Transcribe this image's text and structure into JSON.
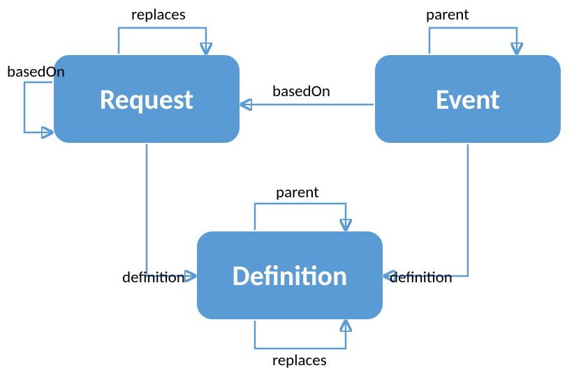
{
  "diagram": {
    "nodes": {
      "request": {
        "label": "Request"
      },
      "event": {
        "label": "Event"
      },
      "definition": {
        "label": "Definition"
      }
    },
    "edges": {
      "request_replaces_self": {
        "label": "replaces",
        "from": "Request",
        "to": "Request"
      },
      "request_basedon_self": {
        "label": "basedOn",
        "from": "Request",
        "to": "Request"
      },
      "event_parent_self": {
        "label": "parent",
        "from": "Event",
        "to": "Event"
      },
      "event_basedon_request": {
        "label": "basedOn",
        "from": "Event",
        "to": "Request"
      },
      "request_definition": {
        "label": "definition",
        "from": "Request",
        "to": "Definition"
      },
      "event_definition": {
        "label": "definition",
        "from": "Event",
        "to": "Definition"
      },
      "definition_parent_self": {
        "label": "parent",
        "from": "Definition",
        "to": "Definition"
      },
      "definition_replaces_self": {
        "label": "replaces",
        "from": "Definition",
        "to": "Definition"
      }
    },
    "colors": {
      "node_fill": "#5b9bd5",
      "node_text": "#ffffff",
      "edge": "#5b9bd5",
      "label": "#000000"
    }
  }
}
